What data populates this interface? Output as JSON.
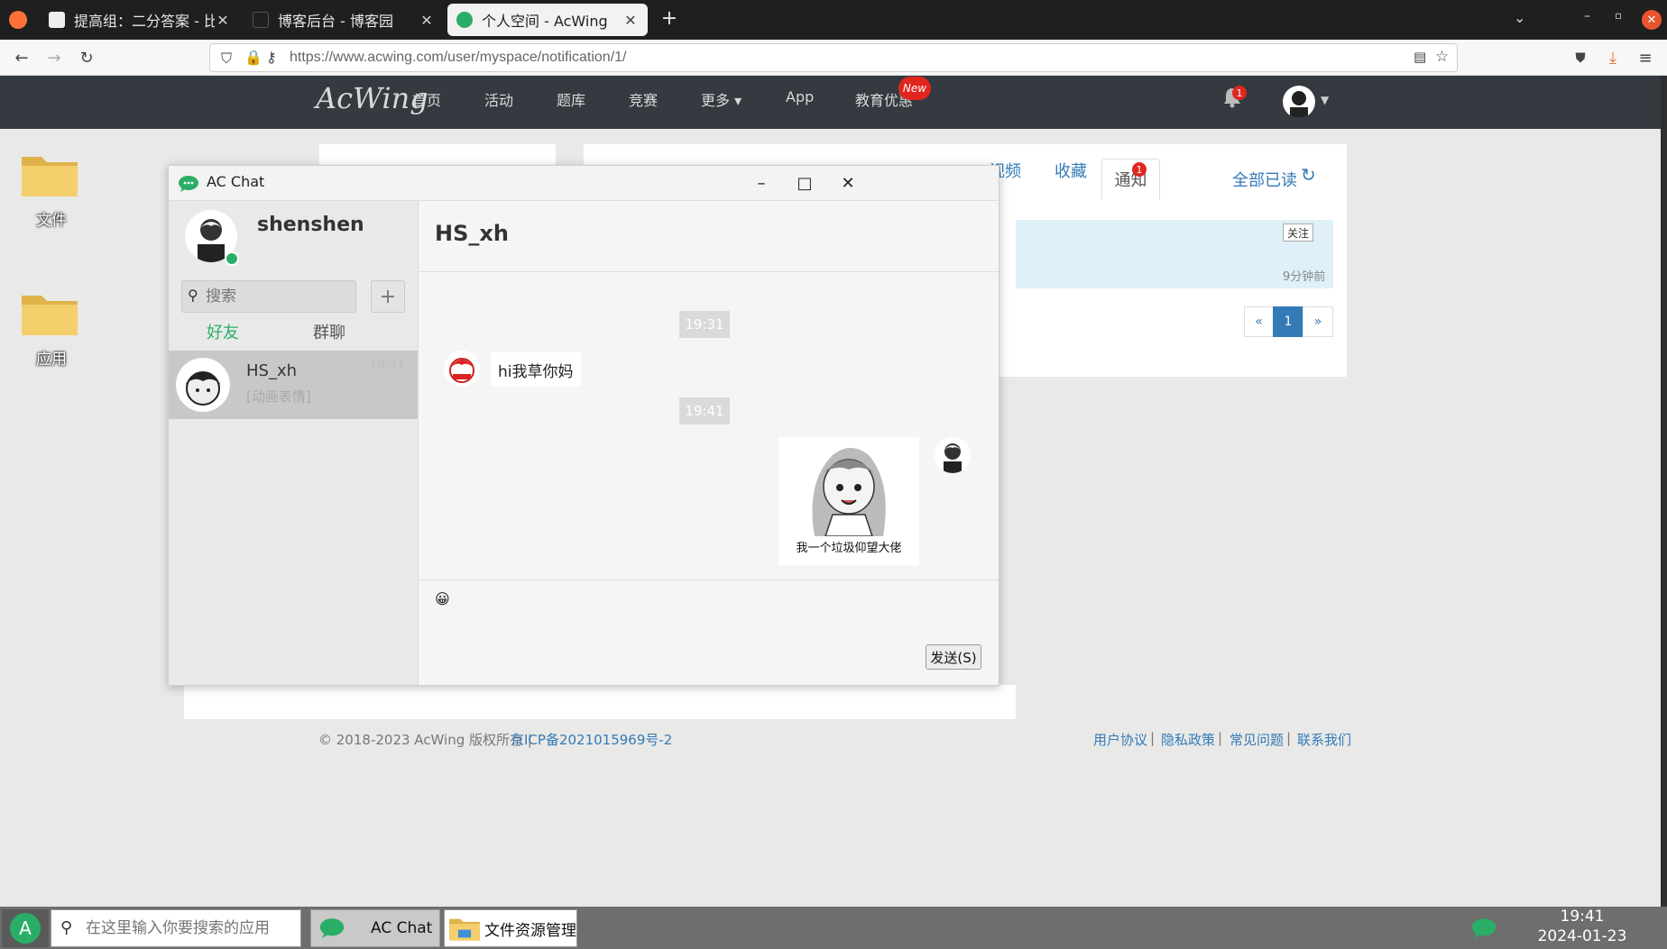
{
  "browser": {
    "tabs": [
      {
        "title": "提高组：二分答案 - 比赛 -",
        "active": false
      },
      {
        "title": "博客后台 - 博客园",
        "active": false
      },
      {
        "title": "个人空间 - AcWing",
        "active": true
      }
    ],
    "new_tab_label": "+",
    "url": "https://www.acwing.com/user/myspace/notification/1/"
  },
  "acwing": {
    "logo": "AcWing",
    "nav": [
      "首页",
      "活动",
      "题库",
      "竞赛",
      "更多 ▾",
      "App",
      "教育优惠"
    ],
    "new_badge": "New",
    "bell_count": "1",
    "subtabs": [
      "视频",
      "收藏"
    ],
    "active_subtab": "通知",
    "subtab_badge": "1",
    "mark_all_read": "全部已读",
    "follow_label": "关注",
    "time_ago": "9分钟前",
    "pager": {
      "prev": "«",
      "current": "1",
      "next": "»"
    },
    "footer": {
      "copyright": "© 2018-2023 AcWing 版权所有  |",
      "icp": "京ICP备2021015969号-2",
      "links": [
        "用户协议",
        "隐私政策",
        "常见问题",
        "联系我们"
      ]
    }
  },
  "desktop": {
    "icons": [
      {
        "label": "文件"
      },
      {
        "label": "应用"
      }
    ]
  },
  "chat": {
    "window_title": "AC Chat",
    "me": {
      "name": "shenshen"
    },
    "search_placeholder": "搜索",
    "add_label": "+",
    "left_tabs": {
      "friends": "好友",
      "groups": "群聊"
    },
    "contacts": [
      {
        "name": "HS_xh",
        "last_message": "[动画表情]",
        "time": "19:41"
      }
    ],
    "peer_name": "HS_xh",
    "messages": [
      {
        "time": "19:31",
        "from": "peer",
        "text": "hi我草你妈"
      },
      {
        "time": "19:41",
        "from": "me",
        "sticker_caption": "我一个垃圾仰望大佬"
      }
    ],
    "emoji": "😀",
    "send_label": "发送(S)"
  },
  "taskbar": {
    "search_placeholder": "在这里输入你要搜索的应用",
    "items": [
      "AC Chat",
      "文件资源管理"
    ],
    "time": "19:41",
    "date": "2024-01-23"
  },
  "colors": {
    "accent_green": "#2aae67",
    "link_blue": "#337ab7",
    "badge_red": "#e0261f"
  }
}
